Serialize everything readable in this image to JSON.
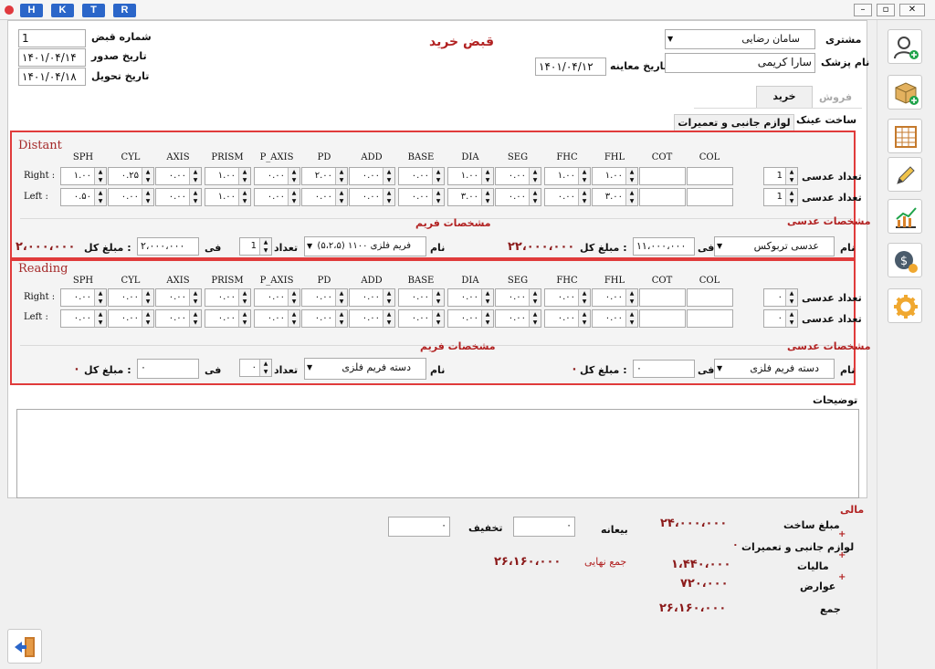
{
  "toolbar": {
    "h": "H",
    "k": "K",
    "t": "T",
    "r": "R"
  },
  "header": {
    "title": "قبض خرید",
    "receipt_no_label": "شماره قبض",
    "receipt_no": "1",
    "issue_date_label": "تاریخ صدور",
    "issue_date": "۱۴۰۱/۰۴/۱۴",
    "delivery_date_label": "تاریخ تحویل",
    "delivery_date": "۱۴۰۱/۰۴/۱۸",
    "exam_date_label": "تاریخ معاینه",
    "exam_date": "۱۴۰۱/۰۴/۱۲",
    "customer_label": "مشتری",
    "customer": "سامان رضایی",
    "doctor_label": "نام پزشک",
    "doctor": "سارا کریمی"
  },
  "tabs": {
    "sell": "فروش",
    "buy": "خرید",
    "make": "ساخت عینک",
    "accessories": "لوازم جانبی و تعمیرات"
  },
  "columns": [
    "SPH",
    "CYL",
    "AXIS",
    "PRISM",
    "P_AXIS",
    "PD",
    "ADD",
    "BASE",
    "DIA",
    "SEG",
    "FHC",
    "FHL",
    "COT",
    "COL"
  ],
  "distant": {
    "title": "Distant",
    "right_label": "Right",
    "left_label": "Left",
    "right": [
      "۱.۰۰",
      "۰.۲۵",
      "۰.۰۰",
      "۱.۰۰",
      "۰.۰۰",
      "۲.۰۰",
      "۰.۰۰",
      "۰.۰۰",
      "۱.۰۰",
      "۰.۰۰",
      "۱.۰۰",
      "۱.۰۰"
    ],
    "left": [
      "۰.۵۰",
      "۰.۰۰",
      "۰.۰۰",
      "۱.۰۰",
      "۰.۰۰",
      "۰.۰۰",
      "۰.۰۰",
      "۰.۰۰",
      "۳.۰۰",
      "۰.۰۰",
      "۰.۰۰",
      "۳.۰۰"
    ],
    "lens_count_label": "تعداد عدسی",
    "lens_count_right": "1",
    "lens_count_left": "1",
    "lens_spec_label": "مشخصات عدسی",
    "frame_spec_label": "مشخصات فریم",
    "lens_name_label": "نام",
    "lens_name": "عدسی تربوکس",
    "lens_unit_label": "فی",
    "lens_unit": "۱۱،۰۰۰،۰۰۰",
    "lens_total_label": "مبلغ کل :",
    "lens_total": "۲۲،۰۰۰،۰۰۰",
    "frame_name_label": "نام",
    "frame_name": "(۵،۲،۵) فریم فلزی ۱۱۰۰",
    "frame_qty_label": "تعداد",
    "frame_qty": "1",
    "frame_unit_label": "فی",
    "frame_unit": "۲،۰۰۰،۰۰۰",
    "frame_total_label": "مبلغ کل :",
    "frame_total": "۲،۰۰۰،۰۰۰"
  },
  "reading": {
    "title": "Reading",
    "right_label": "Right",
    "left_label": "Left",
    "right": [
      "۰.۰۰",
      "۰.۰۰",
      "۰.۰۰",
      "۰.۰۰",
      "۰.۰۰",
      "۰.۰۰",
      "۰.۰۰",
      "۰.۰۰",
      "۰.۰۰",
      "۰.۰۰",
      "۰.۰۰",
      "۰.۰۰"
    ],
    "left": [
      "۰.۰۰",
      "۰.۰۰",
      "۰.۰۰",
      "۰.۰۰",
      "۰.۰۰",
      "۰.۰۰",
      "۰.۰۰",
      "۰.۰۰",
      "۰.۰۰",
      "۰.۰۰",
      "۰.۰۰",
      "۰.۰۰"
    ],
    "lens_count_label": "تعداد عدسی",
    "lens_count_right": "۰",
    "lens_count_left": "۰",
    "lens_spec_label": "مشخصات عدسی",
    "frame_spec_label": "مشخصات فریم",
    "lens_name_label": "نام",
    "lens_name": "دسته فریم فلزی",
    "lens_unit_label": "فی",
    "lens_unit": "۰",
    "lens_total_label": "مبلغ کل :",
    "lens_total": "۰",
    "frame_name_label": "نام",
    "frame_name": "دسته فریم فلزی",
    "frame_qty_label": "تعداد",
    "frame_qty": "۰",
    "frame_unit_label": "فی",
    "frame_unit": "۰",
    "frame_total_label": "مبلغ کل :",
    "frame_total": "۰"
  },
  "notes": {
    "label": "توضیحات",
    "value": ""
  },
  "finance": {
    "title": "مالی",
    "make_label": "مبلغ ساخت",
    "make": "۲۴،۰۰۰،۰۰۰",
    "acc_label": "لوازم جانبی و تعمیرات",
    "acc": "۰",
    "tax_label": "مالیات",
    "tax": "۱،۴۴۰،۰۰۰",
    "duty_label": "عوارض",
    "duty": "۷۲۰،۰۰۰",
    "sum_label": "جمع",
    "sum": "۲۶،۱۶۰،۰۰۰",
    "prepay_label": "بیعانه",
    "prepay": "۰",
    "discount_label": "تخفیف",
    "discount": "۰",
    "final_label": "جمع نهایی",
    "final": "۲۶،۱۶۰،۰۰۰",
    "plus": "+"
  },
  "colors": {
    "accent": "#2b66c9",
    "red_border": "#e03b3b",
    "money": "#8b1a1a"
  }
}
